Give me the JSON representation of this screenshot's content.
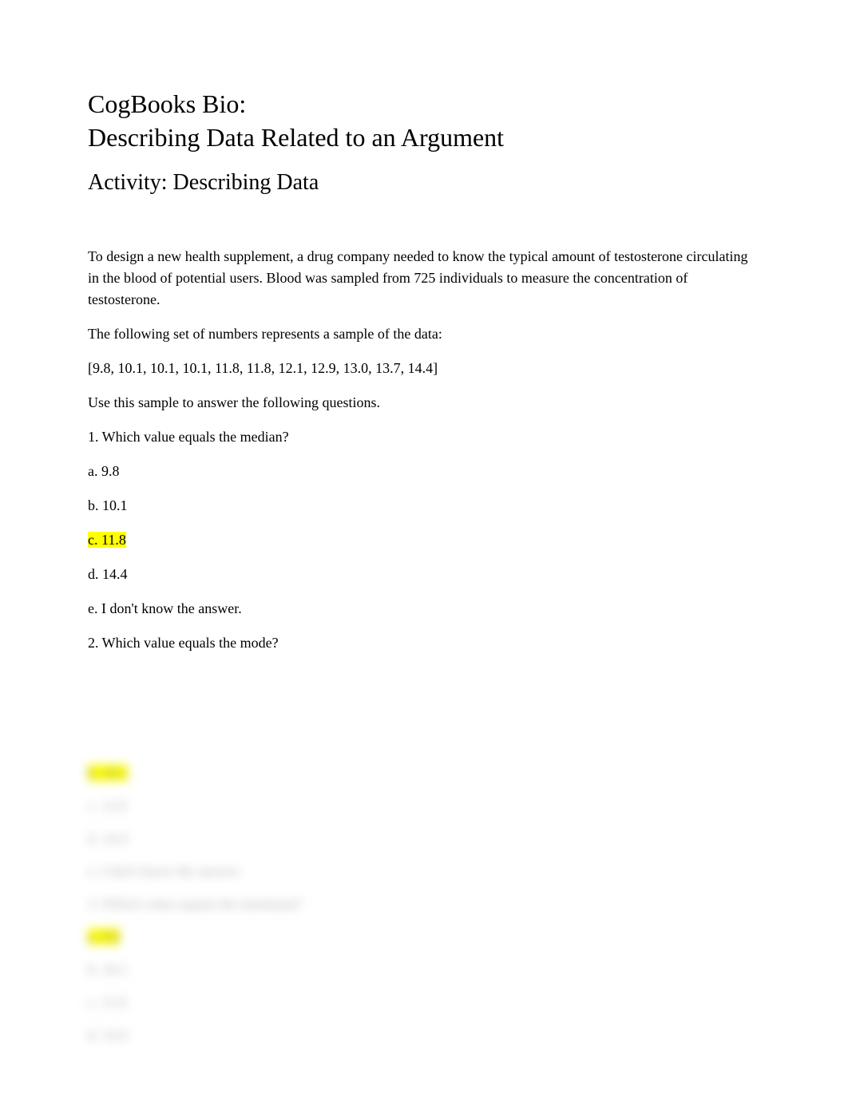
{
  "title": {
    "line1": "CogBooks Bio:",
    "line2": "Describing Data Related to an Argument"
  },
  "subtitle": "Activity: Describing Data",
  "paragraphs": {
    "intro1": "To design a new health supplement, a drug company needed to know the typical amount of testosterone circulating in the blood of potential users. Blood was sampled from 725 individuals to measure the concentration of testosterone.",
    "intro2": "The following set of numbers represents a sample of the data:",
    "dataset": " [9.8, 10.1, 10.1, 10.1, 11.8, 11.8, 12.1, 12.9, 13.0, 13.7, 14.4]",
    "intro3": "Use this sample to answer the following questions."
  },
  "q1": {
    "prompt": "1. Which value equals the median?",
    "a": "a. 9.8",
    "b": "b. 10.1",
    "c": "c. 11.8",
    "d": "d. 14.4",
    "e": "e. I don't know the answer."
  },
  "q2": {
    "prompt": "2. Which value equals the mode?"
  },
  "blurred": {
    "b1": "b. 10.1",
    "c1": "c. 11.8",
    "d1": "d. 14.4",
    "e1": "e. I don't know the answer.",
    "q3": "3. Which value equals the minimum?",
    "a2": "a. 9.8",
    "b2": "b. 10.1",
    "c2": "c. 11.8",
    "d2": "d. 14.4"
  }
}
